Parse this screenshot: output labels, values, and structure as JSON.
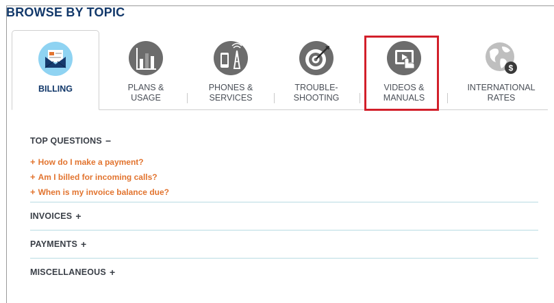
{
  "heading": "BROWSE BY TOPIC",
  "colors": {
    "brand": "#12386a",
    "accent": "#e2742f",
    "highlight": "#d21f2a",
    "divider": "#b7dbe3"
  },
  "tabs": [
    {
      "label_line1": "BILLING",
      "label_line2": "",
      "icon": "envelope-bill-icon",
      "active": true
    },
    {
      "label_line1": "PLANS &",
      "label_line2": "USAGE",
      "icon": "bar-chart-icon",
      "active": false
    },
    {
      "label_line1": "PHONES &",
      "label_line2": "SERVICES",
      "icon": "phone-tower-icon",
      "active": false
    },
    {
      "label_line1": "TROUBLE-",
      "label_line2": "SHOOTING",
      "icon": "target-icon",
      "active": false
    },
    {
      "label_line1": "VIDEOS &",
      "label_line2": "MANUALS",
      "icon": "video-touch-icon",
      "active": false
    },
    {
      "label_line1": "INTERNATIONAL",
      "label_line2": "RATES",
      "icon": "globe-dollar-icon",
      "active": false
    }
  ],
  "top_questions": {
    "title": "TOP QUESTIONS",
    "toggle": "−",
    "items": [
      {
        "plus": "+",
        "text": "How do I make a payment?"
      },
      {
        "plus": "+",
        "text": "Am I billed for incoming calls?"
      },
      {
        "plus": "+",
        "text": "When is my invoice balance due?"
      }
    ]
  },
  "sections": [
    {
      "title": "INVOICES",
      "toggle": "+"
    },
    {
      "title": "PAYMENTS",
      "toggle": "+"
    },
    {
      "title": "MISCELLANEOUS",
      "toggle": "+"
    }
  ]
}
